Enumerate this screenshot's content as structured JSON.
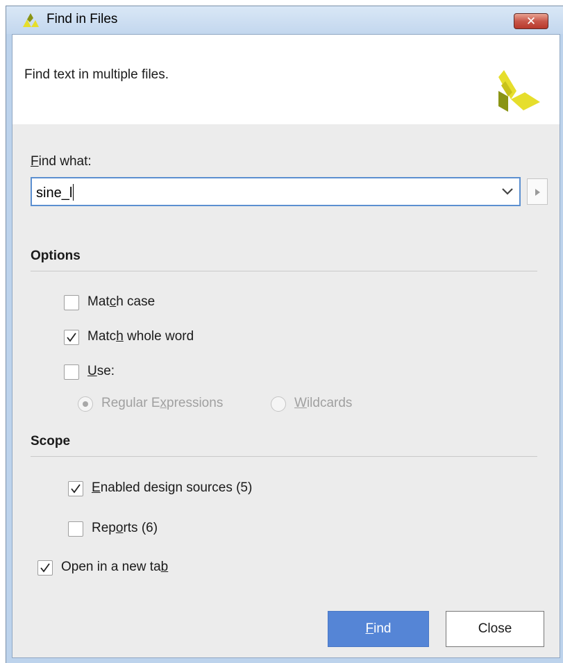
{
  "window": {
    "title": "Find in Files",
    "close_glyph": "✕"
  },
  "header": {
    "description": "Find text in multiple files."
  },
  "find": {
    "label_mnemonic": "F",
    "label_rest": "ind what:",
    "value": "sine_l"
  },
  "options": {
    "title": "Options",
    "match_case": {
      "pre": "Mat",
      "mnemonic": "c",
      "post": "h case",
      "checked": false
    },
    "match_whole_word": {
      "pre": "Matc",
      "mnemonic": "h",
      "post": " whole word",
      "checked": true
    },
    "use": {
      "pre": "",
      "mnemonic": "U",
      "post": "se:",
      "checked": false
    },
    "regex": {
      "pre": "Regular E",
      "mnemonic": "x",
      "post": "pressions",
      "selected": true,
      "enabled": false
    },
    "wildcards": {
      "pre": "",
      "mnemonic": "W",
      "post": "ildcards",
      "selected": false,
      "enabled": false
    }
  },
  "scope": {
    "title": "Scope",
    "enabled_sources": {
      "pre": "",
      "mnemonic": "E",
      "post": "nabled design sources (5)",
      "checked": true
    },
    "reports": {
      "pre": "Rep",
      "mnemonic": "o",
      "post": "rts (6)",
      "checked": false
    }
  },
  "open_new_tab": {
    "pre": "Open in a new ta",
    "mnemonic": "b",
    "post": "",
    "checked": true
  },
  "buttons": {
    "find": {
      "mnemonic": "F",
      "rest": "ind"
    },
    "close": "Close"
  },
  "colors": {
    "accent": "#5585d6",
    "titlebar": "#c3d7ee",
    "logo_yellow": "#e6de2c",
    "logo_olive": "#8a9414"
  },
  "icons": [
    "vivado-logo-icon",
    "close-icon",
    "chevron-down-icon",
    "play-triangle-icon",
    "checkmark-icon"
  ]
}
